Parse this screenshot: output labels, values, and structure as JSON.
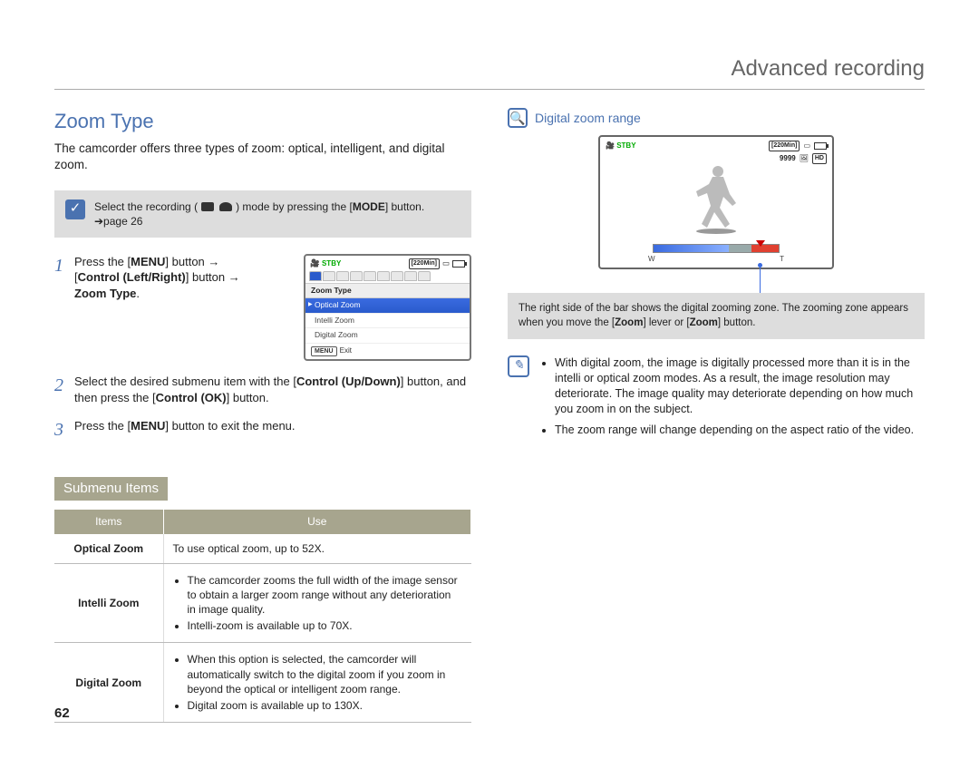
{
  "header": {
    "title": "Advanced recording"
  },
  "page_number": "62",
  "left": {
    "section_title": "Zoom Type",
    "intro": "The camcorder offers three types of zoom: optical, intelligent, and digital zoom.",
    "note_pre": "Select the recording (",
    "note_mid": ") mode by pressing the [",
    "note_mode": "MODE",
    "note_post": "] button. ➔page 26",
    "steps": {
      "s1_a": "Press the [",
      "s1_menu": "MENU",
      "s1_b": "] button",
      "s1_c": "[",
      "s1_ctrl": "Control (Left/Right)",
      "s1_d": "] button",
      "s1_zoom": "Zoom Type",
      "s1_e": ".",
      "s2_a": "Select the desired submenu item with the [",
      "s2_ctrl": "Control (Up/Down)",
      "s2_b": "] button, and then press the [",
      "s2_ok": "Control (OK)",
      "s2_c": "] button.",
      "s3_a": "Press the [",
      "s3_menu": "MENU",
      "s3_b": "] button to exit the menu."
    },
    "lcd": {
      "stby": "STBY",
      "time_remaining": "[220Min]",
      "menu_header": "Zoom Type",
      "items": [
        "Optical Zoom",
        "Intelli Zoom",
        "Digital Zoom"
      ],
      "menu_btn": "MENU",
      "exit": "Exit"
    },
    "submenu_badge": "Submenu Items",
    "table": {
      "h1": "Items",
      "h2": "Use",
      "rows": [
        {
          "name": "Optical Zoom",
          "use_text": "To use optical zoom, up to 52X."
        },
        {
          "name": "Intelli Zoom",
          "use_bullets": [
            "The camcorder zooms the full width of the image sensor to obtain a larger zoom range without any deterioration in image quality.",
            "Intelli-zoom is available up to 70X."
          ]
        },
        {
          "name": "Digital Zoom",
          "use_bullets": [
            "When this option is selected, the camcorder will automatically switch to the digital zoom if you zoom in beyond the optical or intelligent zoom range.",
            "Digital zoom is available up to 130X."
          ]
        }
      ]
    }
  },
  "right": {
    "sub_heading": "Digital zoom range",
    "display": {
      "stby": "STBY",
      "time_remaining": "[220Min]",
      "count": "9999",
      "hd": "HD",
      "w": "W",
      "t": "T"
    },
    "caption_a": "The right side of the bar shows the digital zooming zone. The zooming zone appears when you move the [",
    "caption_zoom1": "Zoom",
    "caption_b": "] lever or [",
    "caption_zoom2": "Zoom",
    "caption_c": "] button.",
    "info": [
      "With digital zoom, the image is digitally processed more than it is in the intelli or optical zoom modes. As a result, the image resolution may deteriorate. The image quality may deteriorate depending on how much you zoom in on the subject.",
      "The zoom range will change depending on the aspect ratio of the video."
    ]
  }
}
